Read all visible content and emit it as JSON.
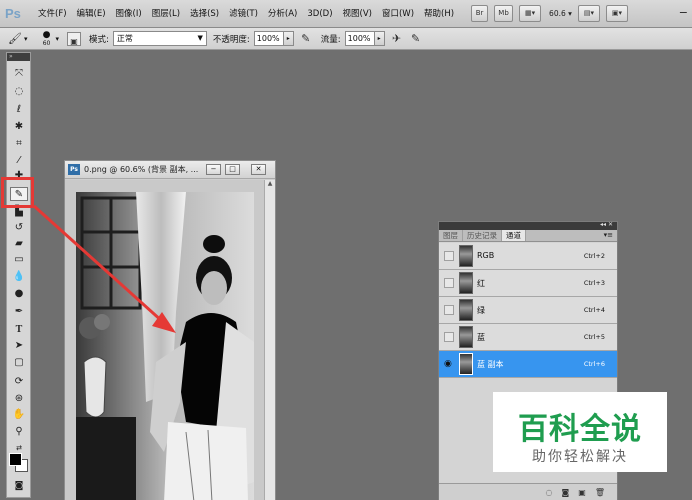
{
  "app": {
    "logo": "Ps"
  },
  "menubar": {
    "items": [
      "文件(F)",
      "编辑(E)",
      "图像(I)",
      "图层(L)",
      "选择(S)",
      "滤镜(T)",
      "分析(A)",
      "3D(D)",
      "视图(V)",
      "窗口(W)",
      "帮助(H)"
    ],
    "bridge_label": "Br",
    "minibridge_label": "Mb",
    "zoom_value": "60.6"
  },
  "options": {
    "brush_size": "60",
    "mode_label": "模式:",
    "mode_value": "正常",
    "opacity_label": "不透明度:",
    "opacity_value": "100%",
    "flow_label": "流量:",
    "flow_value": "100%"
  },
  "document": {
    "title": "0.png @ 60.6% (背景 副本, ..."
  },
  "panel": {
    "tabs": [
      "图层",
      "历史记录",
      "通道"
    ],
    "active_tab": 2,
    "channels": [
      {
        "name": "RGB",
        "shortcut": "Ctrl+2"
      },
      {
        "name": "红",
        "shortcut": "Ctrl+3"
      },
      {
        "name": "绿",
        "shortcut": "Ctrl+4"
      },
      {
        "name": "蓝",
        "shortcut": "Ctrl+5"
      },
      {
        "name": "蓝 副本",
        "shortcut": "Ctrl+6"
      }
    ],
    "selected_channel": 4
  },
  "watermark": {
    "main": "百科全说",
    "sub": "助你轻松解决"
  },
  "colors": {
    "accent_selected": "#3795ef",
    "annotation_red": "#e53935",
    "watermark_green": "#1f9d4f"
  }
}
